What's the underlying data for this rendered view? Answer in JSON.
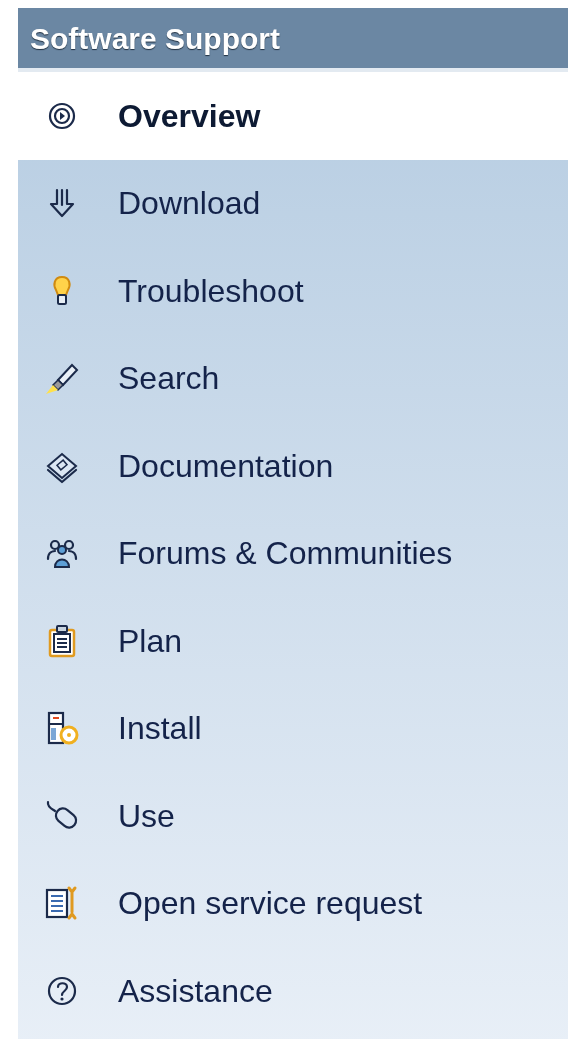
{
  "panel": {
    "title": "Software Support"
  },
  "items": [
    {
      "label": "Overview",
      "kind": "overview",
      "selected": true
    },
    {
      "label": "Download",
      "kind": "download",
      "selected": false
    },
    {
      "label": "Troubleshoot",
      "kind": "troubleshoot",
      "selected": false
    },
    {
      "label": "Search",
      "kind": "search",
      "selected": false
    },
    {
      "label": "Documentation",
      "kind": "documentation",
      "selected": false
    },
    {
      "label": "Forums & Communities",
      "kind": "forums",
      "selected": false
    },
    {
      "label": "Plan",
      "kind": "plan",
      "selected": false
    },
    {
      "label": "Install",
      "kind": "install",
      "selected": false
    },
    {
      "label": "Use",
      "kind": "use",
      "selected": false
    },
    {
      "label": "Open service request",
      "kind": "service",
      "selected": false
    },
    {
      "label": "Assistance",
      "kind": "assistance",
      "selected": false
    }
  ]
}
